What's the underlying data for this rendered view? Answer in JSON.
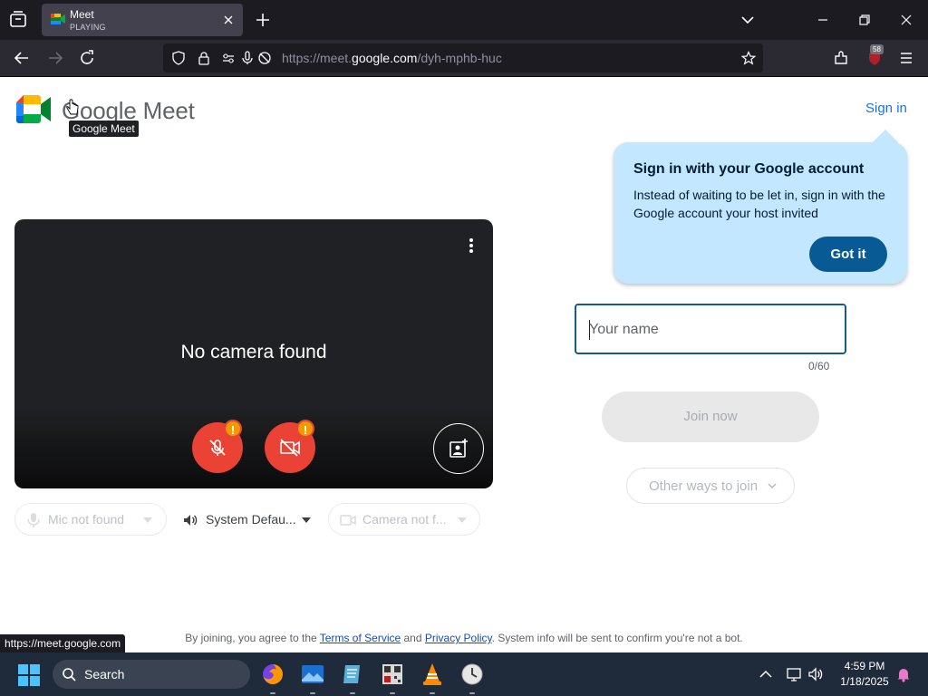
{
  "browser": {
    "tab": {
      "title": "Meet",
      "subtitle": "PLAYING"
    },
    "url": {
      "prefix": "https://meet.",
      "domain": "google.com",
      "path": "/dyh-mphb-huc"
    },
    "extension_badge": "58",
    "status_url": "https://meet.google.com"
  },
  "header": {
    "logo_text": "Google Meet",
    "logo_tooltip": "Google Meet",
    "sign_in": "Sign in"
  },
  "preview": {
    "message": "No camera found",
    "mic_warning": "!",
    "cam_warning": "!"
  },
  "devices": {
    "mic": "Mic not found",
    "speaker": "System Defau...",
    "camera": "Camera not f..."
  },
  "signin_tip": {
    "title": "Sign in with your Google account",
    "body": "Instead of waiting to be let in, sign in with the Google account your host invited",
    "button": "Got it"
  },
  "join": {
    "name_placeholder": "Your name",
    "name_value": "",
    "counter": "0/60",
    "join_button": "Join now",
    "other_ways": "Other ways to join"
  },
  "legal": {
    "prefix": "By joining, you agree to the ",
    "terms": "Terms of Service",
    "and": " and ",
    "privacy": "Privacy Policy",
    "suffix": ". System info will be sent to confirm you're not a bot."
  },
  "taskbar": {
    "search_label": "Search",
    "time": "4:59 PM",
    "date": "1/18/2025"
  },
  "colors": {
    "accent": "#1a73e8",
    "danger": "#ea4335",
    "warning": "#f29900",
    "tip_bg": "#c2e7ff",
    "tip_button": "#075a94"
  }
}
